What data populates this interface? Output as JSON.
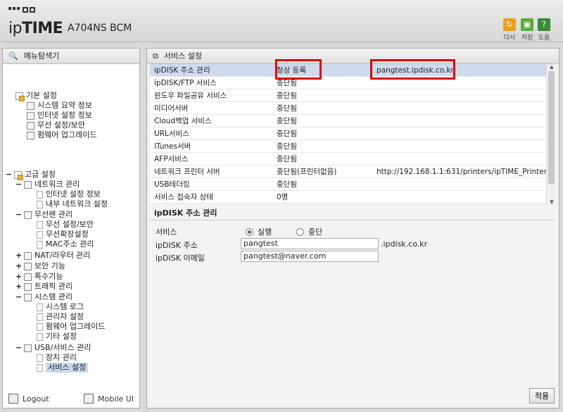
{
  "header": {
    "brand_ip": "ip",
    "brand_time": "TIME",
    "model": "A704NS BCM",
    "buttons": [
      {
        "label": "다시",
        "icon": "restart-icon",
        "color": "#e8a020"
      },
      {
        "label": "저장",
        "icon": "save-icon",
        "color": "#5aaa3a"
      },
      {
        "label": "도움",
        "icon": "help-icon",
        "color": "#3a8a3a"
      }
    ]
  },
  "left": {
    "title": "메뉴탐색기",
    "basic": {
      "label": "기본 설정",
      "items": [
        "시스템 요약 정보",
        "인터넷 설정 정보",
        "무선 설정/보안",
        "펌웨어 업그레이드"
      ]
    },
    "advanced": {
      "label": "고급 설정",
      "network": {
        "label": "네트워크 관리",
        "items": [
          "인터넷 설정 정보",
          "내부 네트워크 설정"
        ]
      },
      "wireless": {
        "label": "무선랜 관리",
        "items": [
          "무선 설정/보안",
          "무선확장설정",
          "MAC주소 관리"
        ]
      },
      "nat": "NAT/라우터 관리",
      "security": "보안 기능",
      "special": "특수기능",
      "traffic": "트래픽 관리",
      "system": {
        "label": "시스템 관리",
        "items": [
          "시스템 로그",
          "관리자 설정",
          "펌웨어 업그레이드",
          "기타 설정"
        ]
      },
      "usb": {
        "label": "USB/서비스 관리",
        "items": [
          "장치 관리",
          "서비스 설정"
        ]
      }
    },
    "logout": "Logout",
    "mobile": "Mobile UI"
  },
  "right": {
    "title": "서비스 설정",
    "services": [
      {
        "name": "ipDISK 주소 관리",
        "status": "정상 등록",
        "info": "pangtest.ipdisk.co.kr"
      },
      {
        "name": "ipDISK/FTP 서비스",
        "status": "중단됨",
        "info": ""
      },
      {
        "name": "윈도우 파일공유 서비스",
        "status": "중단됨",
        "info": ""
      },
      {
        "name": "미디어서버",
        "status": "중단됨",
        "info": ""
      },
      {
        "name": "Cloud백업 서비스",
        "status": "중단됨",
        "info": ""
      },
      {
        "name": "URL서비스",
        "status": "중단됨",
        "info": ""
      },
      {
        "name": "iTunes서버",
        "status": "중단됨",
        "info": ""
      },
      {
        "name": "AFP서비스",
        "status": "중단됨",
        "info": ""
      },
      {
        "name": "네트워크 프린터 서버",
        "status": "중단됨(프린터없음)",
        "info": "http://192.168.1.1:631/printers/ipTIME_Printer"
      },
      {
        "name": "USB테더링",
        "status": "중단됨",
        "info": ""
      },
      {
        "name": "서비스 접속자 상태",
        "status": "0명",
        "info": ""
      }
    ],
    "section_title": "ipDISK 주소 관리",
    "form": {
      "service_label": "서비스",
      "run_label": "실행",
      "stop_label": "중단",
      "address_label": "ipDISK 주소",
      "address_value": "pangtest",
      "address_suffix": ".ipdisk.co.kr",
      "email_label": "ipDISK 이메일",
      "email_value": "pangtest@naver.com"
    },
    "apply": "적용"
  }
}
